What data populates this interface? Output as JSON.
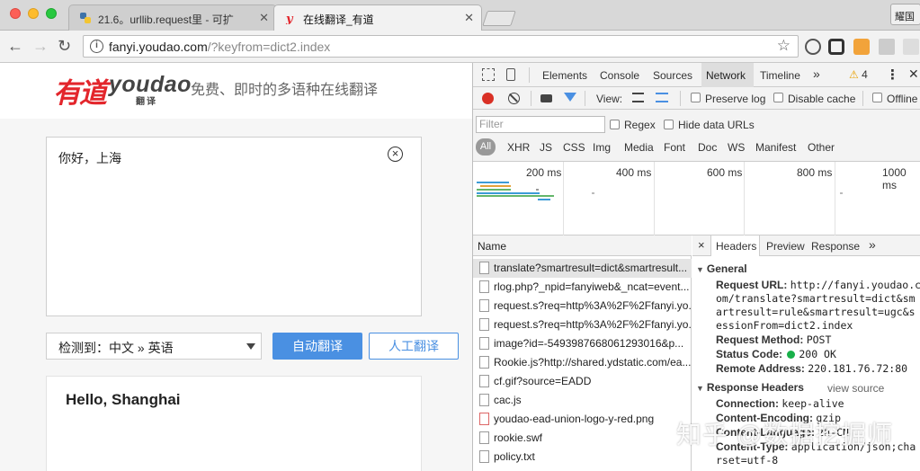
{
  "browser": {
    "tabs": [
      {
        "title": "21.6。urllib.request里 - 可扩",
        "active": false
      },
      {
        "title": "在线翻译_有道",
        "active": true
      }
    ],
    "profile_label": "耀国",
    "url_host": "fanyi.youdao.com",
    "url_rest": "/?keyfrom=dict2.index"
  },
  "page": {
    "logo_cn": "有道",
    "logo_en": "youdao",
    "logo_sub": "翻译",
    "tagline": "免费、即时的多语种在线翻译",
    "source_text": "你好，上海",
    "lang_select": "检测到：中文 » 英语",
    "auto_translate_label": "自动翻译",
    "human_translate_label": "人工翻译",
    "result_text": "Hello, Shanghai"
  },
  "devtools": {
    "tabs": [
      "Elements",
      "Console",
      "Sources",
      "Network",
      "Timeline"
    ],
    "more_tabs": "»",
    "warning_count": "4",
    "controls": {
      "view_label": "View:",
      "preserve_log": "Preserve log",
      "disable_cache": "Disable cache",
      "offline": "Offline"
    },
    "filter": {
      "placeholder": "Filter",
      "regex": "Regex",
      "hide_data_urls": "Hide data URLs",
      "types": [
        "All",
        "XHR",
        "JS",
        "CSS",
        "Img",
        "Media",
        "Font",
        "Doc",
        "WS",
        "Manifest",
        "Other"
      ]
    },
    "timeline_labels": [
      "200 ms",
      "400 ms",
      "600 ms",
      "800 ms",
      "1000 ms"
    ],
    "list_header": "Name",
    "requests": [
      "translate?smartresult=dict&smartresult...",
      "rlog.php?_npid=fanyiweb&_ncat=event...",
      "request.s?req=http%3A%2F%2Ffanyi.yo...",
      "request.s?req=http%3A%2F%2Ffanyi.yo...",
      "image?id=-5493987668061293016&p...",
      "Rookie.js?http://shared.ydstatic.com/ea...",
      "cf.gif?source=EADD",
      "cac.js",
      "youdao-ead-union-logo-y-red.png",
      "rookie.swf",
      "policy.txt"
    ],
    "detail_tabs": [
      "Headers",
      "Preview",
      "Response"
    ],
    "detail_close": "×",
    "general_title": "General",
    "request_url_label": "Request URL:",
    "request_url_lines": [
      "http://fanyi.youdao.c",
      "om/translate?smartresult=dict&sm",
      "artresult=rule&smartresult=ugc&s",
      "essionFrom=dict2.index"
    ],
    "request_method_label": "Request Method:",
    "request_method": "POST",
    "status_code_label": "Status Code:",
    "status_code": "200 OK",
    "remote_address_label": "Remote Address:",
    "remote_address": "220.181.76.72:80",
    "response_headers_title": "Response Headers",
    "view_source": "view source",
    "response_headers": [
      {
        "k": "Connection:",
        "v": "keep-alive"
      },
      {
        "k": "Content-Encoding:",
        "v": "gzip"
      },
      {
        "k": "Content-Language:",
        "v": "zh-CN"
      },
      {
        "k": "Content-Type:",
        "v": "application/json;cha"
      }
    ],
    "content_type_wrap": "rset=utf-8"
  },
  "watermark": "知乎 @数据挖掘师",
  "colors": {
    "accent": "#4a90e2",
    "logo_red": "#e3262c",
    "record_red": "#d93025",
    "status_green": "#19b04a"
  }
}
